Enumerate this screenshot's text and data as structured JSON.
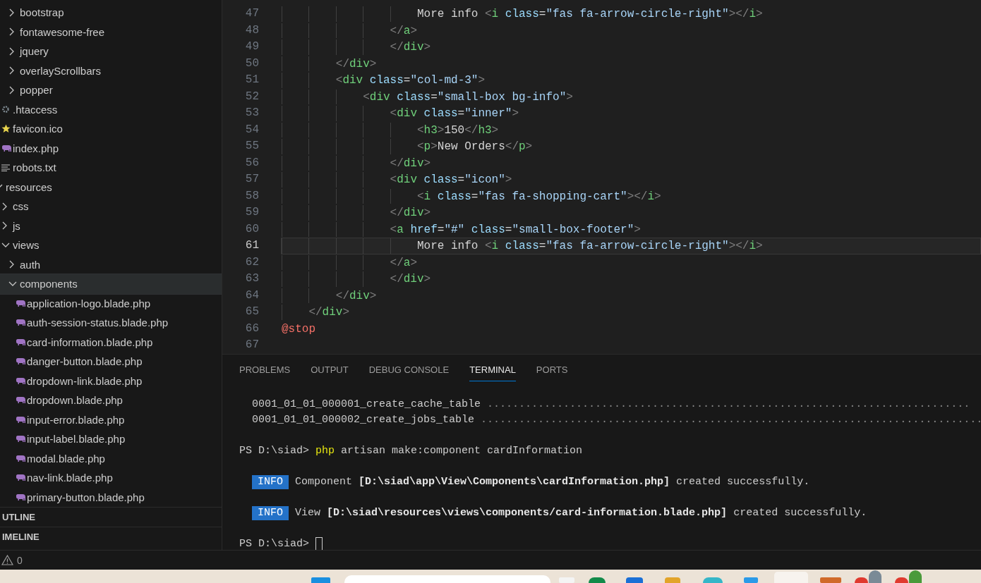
{
  "explorer": {
    "items": [
      {
        "children": [
          {
            "children": [
              {
                "label": "bootstrap",
                "kind": "folder",
                "expanded": false,
                "selected": false
              },
              {
                "label": "fontawesome-free",
                "kind": "folder",
                "expanded": false,
                "selected": false
              },
              {
                "label": "jquery",
                "kind": "folder",
                "expanded": false,
                "selected": false
              },
              {
                "label": "overlayScrollbars",
                "kind": "folder",
                "expanded": false,
                "selected": false
              },
              {
                "label": "popper",
                "kind": "folder",
                "expanded": false,
                "selected": false
              }
            ]
          },
          {
            "label": ".htaccess",
            "kind": "config",
            "selected": false
          },
          {
            "label": "favicon.ico",
            "kind": "favicon",
            "selected": false
          },
          {
            "label": "index.php",
            "kind": "php",
            "selected": false
          },
          {
            "label": "robots.txt",
            "kind": "text",
            "selected": false
          }
        ]
      },
      {
        "label": "resources",
        "kind": "folder",
        "expanded": true,
        "selected": false,
        "children": [
          {
            "label": "css",
            "kind": "folder",
            "expanded": false,
            "selected": false
          },
          {
            "label": "js",
            "kind": "folder",
            "expanded": false,
            "selected": false
          },
          {
            "label": "views",
            "kind": "folder",
            "expanded": true,
            "selected": false,
            "children": [
              {
                "label": "auth",
                "kind": "folder",
                "expanded": false,
                "selected": false
              },
              {
                "label": "components",
                "kind": "folder",
                "expanded": true,
                "selected": true,
                "children": [
                  {
                    "label": "application-logo.blade.php",
                    "kind": "php",
                    "selected": false
                  },
                  {
                    "label": "auth-session-status.blade.php",
                    "kind": "php",
                    "selected": false
                  },
                  {
                    "label": "card-information.blade.php",
                    "kind": "php",
                    "selected": false
                  },
                  {
                    "label": "danger-button.blade.php",
                    "kind": "php",
                    "selected": false
                  },
                  {
                    "label": "dropdown-link.blade.php",
                    "kind": "php",
                    "selected": false
                  },
                  {
                    "label": "dropdown.blade.php",
                    "kind": "php",
                    "selected": false
                  },
                  {
                    "label": "input-error.blade.php",
                    "kind": "php",
                    "selected": false
                  },
                  {
                    "label": "input-label.blade.php",
                    "kind": "php",
                    "selected": false
                  },
                  {
                    "label": "modal.blade.php",
                    "kind": "php",
                    "selected": false
                  },
                  {
                    "label": "nav-link.blade.php",
                    "kind": "php",
                    "selected": false
                  },
                  {
                    "label": "primary-button.blade.php",
                    "kind": "php",
                    "selected": false
                  }
                ]
              }
            ]
          }
        ]
      }
    ],
    "sections": [
      "UTLINE",
      "IMELINE"
    ]
  },
  "editor": {
    "lines": [
      {
        "number": "47",
        "current": false,
        "tokens": [
          {
            "text": "                    More info ",
            "kind": "text"
          },
          {
            "text": "<",
            "kind": "punct"
          },
          {
            "text": "i",
            "kind": "tag"
          },
          {
            "text": " class",
            "kind": "attr"
          },
          {
            "text": "=",
            "kind": "text"
          },
          {
            "text": "\"fas fa-arrow-circle-right\"",
            "kind": "string"
          },
          {
            "text": "></",
            "kind": "punct"
          },
          {
            "text": "i",
            "kind": "tag"
          },
          {
            "text": ">",
            "kind": "punct"
          }
        ]
      },
      {
        "number": "48",
        "current": false,
        "tokens": [
          {
            "text": "                </",
            "kind": "punct"
          },
          {
            "text": "a",
            "kind": "tag"
          },
          {
            "text": ">",
            "kind": "punct"
          }
        ]
      },
      {
        "number": "49",
        "current": false,
        "tokens": [
          {
            "text": "                </",
            "kind": "punct"
          },
          {
            "text": "div",
            "kind": "tag"
          },
          {
            "text": ">",
            "kind": "punct"
          }
        ]
      },
      {
        "number": "50",
        "current": false,
        "tokens": [
          {
            "text": "        </",
            "kind": "punct"
          },
          {
            "text": "div",
            "kind": "tag"
          },
          {
            "text": ">",
            "kind": "punct"
          }
        ]
      },
      {
        "number": "51",
        "current": false,
        "tokens": [
          {
            "text": "        <",
            "kind": "punct"
          },
          {
            "text": "div",
            "kind": "tag"
          },
          {
            "text": " class",
            "kind": "attr"
          },
          {
            "text": "=",
            "kind": "text"
          },
          {
            "text": "\"col-md-3\"",
            "kind": "string"
          },
          {
            "text": ">",
            "kind": "punct"
          }
        ]
      },
      {
        "number": "52",
        "current": false,
        "tokens": [
          {
            "text": "            <",
            "kind": "punct"
          },
          {
            "text": "div",
            "kind": "tag"
          },
          {
            "text": " class",
            "kind": "attr"
          },
          {
            "text": "=",
            "kind": "text"
          },
          {
            "text": "\"small-box bg-info\"",
            "kind": "string"
          },
          {
            "text": ">",
            "kind": "punct"
          }
        ]
      },
      {
        "number": "53",
        "current": false,
        "tokens": [
          {
            "text": "                <",
            "kind": "punct"
          },
          {
            "text": "div",
            "kind": "tag"
          },
          {
            "text": " class",
            "kind": "attr"
          },
          {
            "text": "=",
            "kind": "text"
          },
          {
            "text": "\"inner\"",
            "kind": "string"
          },
          {
            "text": ">",
            "kind": "punct"
          }
        ]
      },
      {
        "number": "54",
        "current": false,
        "tokens": [
          {
            "text": "                    <",
            "kind": "punct"
          },
          {
            "text": "h3",
            "kind": "tag"
          },
          {
            "text": ">",
            "kind": "punct"
          },
          {
            "text": "150",
            "kind": "text"
          },
          {
            "text": "</",
            "kind": "punct"
          },
          {
            "text": "h3",
            "kind": "tag"
          },
          {
            "text": ">",
            "kind": "punct"
          }
        ]
      },
      {
        "number": "55",
        "current": false,
        "tokens": [
          {
            "text": "                    <",
            "kind": "punct"
          },
          {
            "text": "p",
            "kind": "tag"
          },
          {
            "text": ">",
            "kind": "punct"
          },
          {
            "text": "New Orders",
            "kind": "text"
          },
          {
            "text": "</",
            "kind": "punct"
          },
          {
            "text": "p",
            "kind": "tag"
          },
          {
            "text": ">",
            "kind": "punct"
          }
        ]
      },
      {
        "number": "56",
        "current": false,
        "tokens": [
          {
            "text": "                </",
            "kind": "punct"
          },
          {
            "text": "div",
            "kind": "tag"
          },
          {
            "text": ">",
            "kind": "punct"
          }
        ]
      },
      {
        "number": "57",
        "current": false,
        "tokens": [
          {
            "text": "                <",
            "kind": "punct"
          },
          {
            "text": "div",
            "kind": "tag"
          },
          {
            "text": " class",
            "kind": "attr"
          },
          {
            "text": "=",
            "kind": "text"
          },
          {
            "text": "\"icon\"",
            "kind": "string"
          },
          {
            "text": ">",
            "kind": "punct"
          }
        ]
      },
      {
        "number": "58",
        "current": false,
        "tokens": [
          {
            "text": "                    <",
            "kind": "punct"
          },
          {
            "text": "i",
            "kind": "tag"
          },
          {
            "text": " class",
            "kind": "attr"
          },
          {
            "text": "=",
            "kind": "text"
          },
          {
            "text": "\"fas fa-shopping-cart\"",
            "kind": "string"
          },
          {
            "text": "></",
            "kind": "punct"
          },
          {
            "text": "i",
            "kind": "tag"
          },
          {
            "text": ">",
            "kind": "punct"
          }
        ]
      },
      {
        "number": "59",
        "current": false,
        "tokens": [
          {
            "text": "                </",
            "kind": "punct"
          },
          {
            "text": "div",
            "kind": "tag"
          },
          {
            "text": ">",
            "kind": "punct"
          }
        ]
      },
      {
        "number": "60",
        "current": false,
        "tokens": [
          {
            "text": "                <",
            "kind": "punct"
          },
          {
            "text": "a",
            "kind": "tag"
          },
          {
            "text": " href",
            "kind": "attr"
          },
          {
            "text": "=",
            "kind": "text"
          },
          {
            "text": "\"#\"",
            "kind": "string"
          },
          {
            "text": " class",
            "kind": "attr"
          },
          {
            "text": "=",
            "kind": "text"
          },
          {
            "text": "\"small-box-footer\"",
            "kind": "string"
          },
          {
            "text": ">",
            "kind": "punct"
          }
        ]
      },
      {
        "number": "61",
        "current": true,
        "tokens": [
          {
            "text": "                    More info ",
            "kind": "text"
          },
          {
            "text": "<",
            "kind": "punct"
          },
          {
            "text": "i",
            "kind": "tag"
          },
          {
            "text": " class",
            "kind": "attr"
          },
          {
            "text": "=",
            "kind": "text"
          },
          {
            "text": "\"fas fa-arrow-circle-right\"",
            "kind": "string"
          },
          {
            "text": "></",
            "kind": "punct"
          },
          {
            "text": "i",
            "kind": "tag"
          },
          {
            "text": ">",
            "kind": "punct"
          }
        ]
      },
      {
        "number": "62",
        "current": false,
        "tokens": [
          {
            "text": "                </",
            "kind": "punct"
          },
          {
            "text": "a",
            "kind": "tag"
          },
          {
            "text": ">",
            "kind": "punct"
          }
        ]
      },
      {
        "number": "63",
        "current": false,
        "tokens": [
          {
            "text": "                </",
            "kind": "punct"
          },
          {
            "text": "div",
            "kind": "tag"
          },
          {
            "text": ">",
            "kind": "punct"
          }
        ]
      },
      {
        "number": "64",
        "current": false,
        "tokens": [
          {
            "text": "        </",
            "kind": "punct"
          },
          {
            "text": "div",
            "kind": "tag"
          },
          {
            "text": ">",
            "kind": "punct"
          }
        ]
      },
      {
        "number": "65",
        "current": false,
        "tokens": [
          {
            "text": "    </",
            "kind": "punct"
          },
          {
            "text": "div",
            "kind": "tag"
          },
          {
            "text": ">",
            "kind": "punct"
          }
        ]
      },
      {
        "number": "66",
        "current": false,
        "tokens": [
          {
            "text": "@stop",
            "kind": "directive"
          }
        ]
      },
      {
        "number": "67",
        "current": false
      }
    ]
  },
  "panel": {
    "tabs": [
      {
        "label": "PROBLEMS",
        "selected": false
      },
      {
        "label": "OUTPUT",
        "selected": false
      },
      {
        "label": "DEBUG CONSOLE",
        "selected": false
      },
      {
        "label": "TERMINAL",
        "selected": true
      },
      {
        "label": "PORTS",
        "selected": false
      }
    ],
    "terminal": [
      {
        "kind": "migration",
        "name": "0001_01_01_000001_create_cache_table",
        "dots": "............................................................................"
      },
      {
        "kind": "migration",
        "name": "0001_01_01_000002_create_jobs_table",
        "dots": "..............................................................................."
      },
      {
        "kind": "blank"
      },
      {
        "kind": "command",
        "prompt": "PS D:\\siad>",
        "program": "php",
        "args": "artisan make:component cardInformation"
      },
      {
        "kind": "blank"
      },
      {
        "kind": "info",
        "badge": "INFO",
        "message": "Component **[D:\\siad\\app\\View\\Components\\cardInformation.php]** created successfully."
      },
      {
        "kind": "blank"
      },
      {
        "kind": "info",
        "badge": "INFO",
        "message": "View **[D:\\siad\\resources\\views\\components/card-information.blade.php]** created successfully."
      },
      {
        "kind": "blank"
      },
      {
        "kind": "prompt",
        "prompt": "PS D:\\siad>",
        "cursor": true
      }
    ]
  },
  "status_bar": {
    "warnings": "0"
  }
}
